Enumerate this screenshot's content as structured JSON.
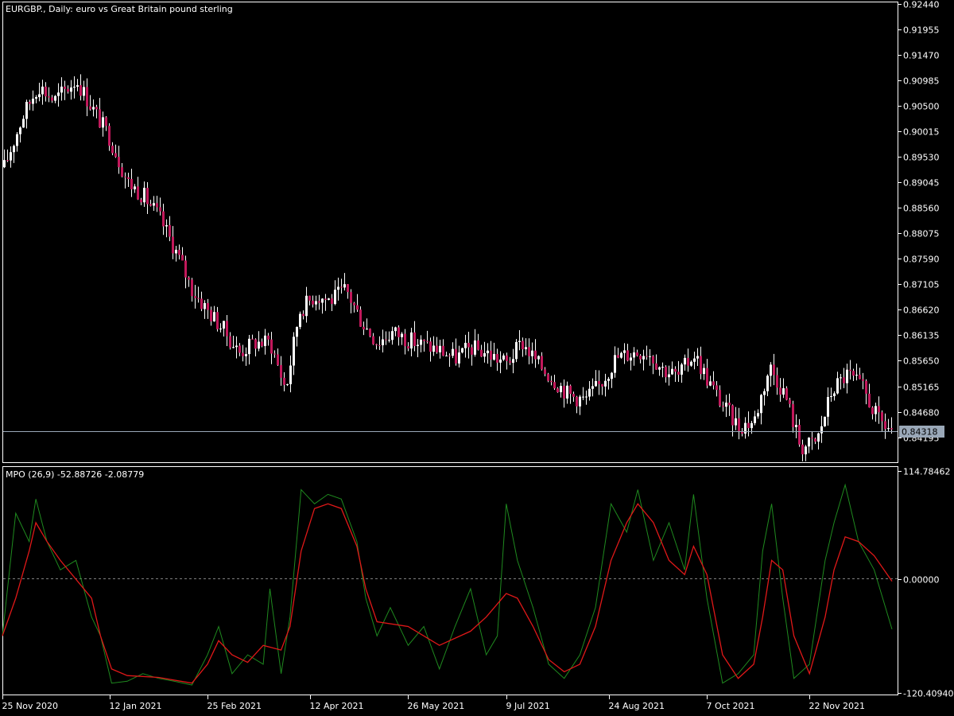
{
  "window": {
    "price_caption": "EURGBP., Daily:  euro vs Great Britain pound sterling",
    "indicator_caption": "MPO (26,9) -52.88726 -2.08779"
  },
  "colors": {
    "background": "#000000",
    "frame": "#ffffff",
    "bull_candle": "#ffffff",
    "bear_candle": "#c2185b",
    "wick": "#ffffff",
    "mpo_line": "#1f8a1f",
    "signal_line": "#e01818",
    "price_line": "#9aa8b8",
    "zero_line": "#808080"
  },
  "chart_data": [
    {
      "type": "candlestick",
      "title": "EURGBP., Daily:  euro vs Great Britain pound sterling",
      "y_ticks": [
        "0.92440",
        "0.91955",
        "0.91470",
        "0.90985",
        "0.90500",
        "0.90015",
        "0.89530",
        "0.89045",
        "0.88560",
        "0.88075",
        "0.87590",
        "0.87105",
        "0.86620",
        "0.86135",
        "0.85650",
        "0.85165",
        "0.84680",
        "0.84195"
      ],
      "ylim": [
        0.8375,
        0.9244
      ],
      "current_price": "0.84318",
      "x_ticks": [
        "25 Nov 2020",
        "12 Jan 2021",
        "25 Feb 2021",
        "12 Apr 2021",
        "26 May 2021",
        "9 Jul 2021",
        "24 Aug 2021",
        "7 Oct 2021",
        "22 Nov 2021"
      ],
      "close_series": [
        {
          "date": "2020-11-25",
          "close": 0.8925
        },
        {
          "date": "2020-12-04",
          "close": 0.903
        },
        {
          "date": "2020-12-11",
          "close": 0.909
        },
        {
          "date": "2020-12-18",
          "close": 0.906
        },
        {
          "date": "2020-12-28",
          "close": 0.91
        },
        {
          "date": "2021-01-05",
          "close": 0.904
        },
        {
          "date": "2021-01-12",
          "close": 0.899
        },
        {
          "date": "2021-01-20",
          "close": 0.8905
        },
        {
          "date": "2021-01-27",
          "close": 0.888
        },
        {
          "date": "2021-02-03",
          "close": 0.884
        },
        {
          "date": "2021-02-10",
          "close": 0.878
        },
        {
          "date": "2021-02-18",
          "close": 0.87
        },
        {
          "date": "2021-02-25",
          "close": 0.866
        },
        {
          "date": "2021-03-04",
          "close": 0.8625
        },
        {
          "date": "2021-03-11",
          "close": 0.858
        },
        {
          "date": "2021-03-18",
          "close": 0.86
        },
        {
          "date": "2021-03-25",
          "close": 0.86
        },
        {
          "date": "2021-04-01",
          "close": 0.851
        },
        {
          "date": "2021-04-07",
          "close": 0.866
        },
        {
          "date": "2021-04-14",
          "close": 0.869
        },
        {
          "date": "2021-04-21",
          "close": 0.868
        },
        {
          "date": "2021-04-28",
          "close": 0.87
        },
        {
          "date": "2021-05-05",
          "close": 0.864
        },
        {
          "date": "2021-05-12",
          "close": 0.86
        },
        {
          "date": "2021-05-19",
          "close": 0.862
        },
        {
          "date": "2021-05-26",
          "close": 0.8605
        },
        {
          "date": "2021-06-02",
          "close": 0.8595
        },
        {
          "date": "2021-06-09",
          "close": 0.8585
        },
        {
          "date": "2021-06-16",
          "close": 0.857
        },
        {
          "date": "2021-06-23",
          "close": 0.859
        },
        {
          "date": "2021-06-30",
          "close": 0.858
        },
        {
          "date": "2021-07-09",
          "close": 0.856
        },
        {
          "date": "2021-07-16",
          "close": 0.86
        },
        {
          "date": "2021-07-23",
          "close": 0.856
        },
        {
          "date": "2021-07-30",
          "close": 0.853
        },
        {
          "date": "2021-08-06",
          "close": 0.85
        },
        {
          "date": "2021-08-13",
          "close": 0.849
        },
        {
          "date": "2021-08-20",
          "close": 0.852
        },
        {
          "date": "2021-08-27",
          "close": 0.857
        },
        {
          "date": "2021-09-03",
          "close": 0.858
        },
        {
          "date": "2021-09-10",
          "close": 0.8585
        },
        {
          "date": "2021-09-17",
          "close": 0.855
        },
        {
          "date": "2021-09-24",
          "close": 0.8535
        },
        {
          "date": "2021-10-01",
          "close": 0.858
        },
        {
          "date": "2021-10-07",
          "close": 0.853
        },
        {
          "date": "2021-10-14",
          "close": 0.848
        },
        {
          "date": "2021-10-21",
          "close": 0.844
        },
        {
          "date": "2021-10-28",
          "close": 0.845
        },
        {
          "date": "2021-11-04",
          "close": 0.8555
        },
        {
          "date": "2021-11-11",
          "close": 0.85
        },
        {
          "date": "2021-11-18",
          "close": 0.84
        },
        {
          "date": "2021-11-25",
          "close": 0.841
        },
        {
          "date": "2021-12-02",
          "close": 0.851
        },
        {
          "date": "2021-12-09",
          "close": 0.854
        },
        {
          "date": "2021-12-16",
          "close": 0.851
        },
        {
          "date": "2021-12-23",
          "close": 0.845
        },
        {
          "date": "2021-12-29",
          "close": 0.8432
        }
      ]
    },
    {
      "type": "line",
      "title": "MPO (26,9) -52.88726 -2.08779",
      "y_ticks": [
        "114.78462",
        "0.00000",
        "-120.40940"
      ],
      "ylim": [
        -120.4094,
        114.78462
      ],
      "zero_line": true,
      "series": [
        {
          "key": "mpo",
          "points": [
            {
              "date": "2020-11-25",
              "value": -60
            },
            {
              "date": "2020-12-01",
              "value": 70
            },
            {
              "date": "2020-12-07",
              "value": 40
            },
            {
              "date": "2020-12-10",
              "value": 85
            },
            {
              "date": "2020-12-15",
              "value": 40
            },
            {
              "date": "2020-12-21",
              "value": 10
            },
            {
              "date": "2020-12-28",
              "value": 20
            },
            {
              "date": "2021-01-04",
              "value": -40
            },
            {
              "date": "2021-01-08",
              "value": -60
            },
            {
              "date": "2021-01-13",
              "value": -110
            },
            {
              "date": "2021-01-20",
              "value": -108
            },
            {
              "date": "2021-01-27",
              "value": -100
            },
            {
              "date": "2021-02-03",
              "value": -105
            },
            {
              "date": "2021-02-10",
              "value": -108
            },
            {
              "date": "2021-02-18",
              "value": -112
            },
            {
              "date": "2021-02-25",
              "value": -80
            },
            {
              "date": "2021-03-02",
              "value": -50
            },
            {
              "date": "2021-03-08",
              "value": -100
            },
            {
              "date": "2021-03-15",
              "value": -80
            },
            {
              "date": "2021-03-22",
              "value": -90
            },
            {
              "date": "2021-03-25",
              "value": -10
            },
            {
              "date": "2021-03-30",
              "value": -100
            },
            {
              "date": "2021-04-03",
              "value": -40
            },
            {
              "date": "2021-04-08",
              "value": 95
            },
            {
              "date": "2021-04-14",
              "value": 80
            },
            {
              "date": "2021-04-20",
              "value": 90
            },
            {
              "date": "2021-04-26",
              "value": 85
            },
            {
              "date": "2021-05-03",
              "value": 40
            },
            {
              "date": "2021-05-07",
              "value": -20
            },
            {
              "date": "2021-05-12",
              "value": -60
            },
            {
              "date": "2021-05-18",
              "value": -30
            },
            {
              "date": "2021-05-26",
              "value": -70
            },
            {
              "date": "2021-06-02",
              "value": -50
            },
            {
              "date": "2021-06-09",
              "value": -95
            },
            {
              "date": "2021-06-16",
              "value": -50
            },
            {
              "date": "2021-06-23",
              "value": -10
            },
            {
              "date": "2021-06-30",
              "value": -80
            },
            {
              "date": "2021-07-05",
              "value": -60
            },
            {
              "date": "2021-07-09",
              "value": 80
            },
            {
              "date": "2021-07-14",
              "value": 20
            },
            {
              "date": "2021-07-21",
              "value": -30
            },
            {
              "date": "2021-07-28",
              "value": -90
            },
            {
              "date": "2021-08-04",
              "value": -105
            },
            {
              "date": "2021-08-11",
              "value": -80
            },
            {
              "date": "2021-08-18",
              "value": -30
            },
            {
              "date": "2021-08-25",
              "value": 80
            },
            {
              "date": "2021-09-01",
              "value": 50
            },
            {
              "date": "2021-09-06",
              "value": 95
            },
            {
              "date": "2021-09-13",
              "value": 20
            },
            {
              "date": "2021-09-20",
              "value": 60
            },
            {
              "date": "2021-09-27",
              "value": 10
            },
            {
              "date": "2021-10-01",
              "value": 90
            },
            {
              "date": "2021-10-07",
              "value": -20
            },
            {
              "date": "2021-10-14",
              "value": -110
            },
            {
              "date": "2021-10-21",
              "value": -100
            },
            {
              "date": "2021-10-28",
              "value": -80
            },
            {
              "date": "2021-11-01",
              "value": 30
            },
            {
              "date": "2021-11-05",
              "value": 80
            },
            {
              "date": "2021-11-10",
              "value": -20
            },
            {
              "date": "2021-11-15",
              "value": -105
            },
            {
              "date": "2021-11-22",
              "value": -90
            },
            {
              "date": "2021-11-29",
              "value": 20
            },
            {
              "date": "2021-12-03",
              "value": 60
            },
            {
              "date": "2021-12-08",
              "value": 100
            },
            {
              "date": "2021-12-14",
              "value": 40
            },
            {
              "date": "2021-12-21",
              "value": 10
            },
            {
              "date": "2021-12-29",
              "value": -52.89
            }
          ]
        },
        {
          "key": "signal",
          "points": [
            {
              "date": "2020-11-25",
              "value": -60
            },
            {
              "date": "2020-12-01",
              "value": -20
            },
            {
              "date": "2020-12-07",
              "value": 30
            },
            {
              "date": "2020-12-10",
              "value": 60
            },
            {
              "date": "2020-12-15",
              "value": 40
            },
            {
              "date": "2020-12-21",
              "value": 20
            },
            {
              "date": "2021-01-04",
              "value": -20
            },
            {
              "date": "2021-01-08",
              "value": -60
            },
            {
              "date": "2021-01-13",
              "value": -95
            },
            {
              "date": "2021-01-20",
              "value": -102
            },
            {
              "date": "2021-02-03",
              "value": -104
            },
            {
              "date": "2021-02-18",
              "value": -110
            },
            {
              "date": "2021-02-25",
              "value": -90
            },
            {
              "date": "2021-03-02",
              "value": -65
            },
            {
              "date": "2021-03-08",
              "value": -80
            },
            {
              "date": "2021-03-15",
              "value": -88
            },
            {
              "date": "2021-03-22",
              "value": -70
            },
            {
              "date": "2021-03-30",
              "value": -75
            },
            {
              "date": "2021-04-03",
              "value": -50
            },
            {
              "date": "2021-04-08",
              "value": 30
            },
            {
              "date": "2021-04-14",
              "value": 75
            },
            {
              "date": "2021-04-20",
              "value": 80
            },
            {
              "date": "2021-04-26",
              "value": 75
            },
            {
              "date": "2021-05-03",
              "value": 35
            },
            {
              "date": "2021-05-07",
              "value": -10
            },
            {
              "date": "2021-05-12",
              "value": -45
            },
            {
              "date": "2021-05-26",
              "value": -50
            },
            {
              "date": "2021-06-09",
              "value": -70
            },
            {
              "date": "2021-06-23",
              "value": -55
            },
            {
              "date": "2021-06-30",
              "value": -40
            },
            {
              "date": "2021-07-09",
              "value": -15
            },
            {
              "date": "2021-07-14",
              "value": -20
            },
            {
              "date": "2021-07-21",
              "value": -50
            },
            {
              "date": "2021-07-28",
              "value": -85
            },
            {
              "date": "2021-08-04",
              "value": -98
            },
            {
              "date": "2021-08-11",
              "value": -90
            },
            {
              "date": "2021-08-18",
              "value": -50
            },
            {
              "date": "2021-08-25",
              "value": 20
            },
            {
              "date": "2021-09-01",
              "value": 60
            },
            {
              "date": "2021-09-06",
              "value": 80
            },
            {
              "date": "2021-09-13",
              "value": 60
            },
            {
              "date": "2021-09-20",
              "value": 20
            },
            {
              "date": "2021-09-27",
              "value": 5
            },
            {
              "date": "2021-10-01",
              "value": 35
            },
            {
              "date": "2021-10-07",
              "value": 5
            },
            {
              "date": "2021-10-14",
              "value": -80
            },
            {
              "date": "2021-10-21",
              "value": -105
            },
            {
              "date": "2021-10-28",
              "value": -90
            },
            {
              "date": "2021-11-01",
              "value": -40
            },
            {
              "date": "2021-11-05",
              "value": 20
            },
            {
              "date": "2021-11-10",
              "value": 10
            },
            {
              "date": "2021-11-15",
              "value": -60
            },
            {
              "date": "2021-11-22",
              "value": -100
            },
            {
              "date": "2021-11-29",
              "value": -40
            },
            {
              "date": "2021-12-03",
              "value": 10
            },
            {
              "date": "2021-12-08",
              "value": 45
            },
            {
              "date": "2021-12-14",
              "value": 40
            },
            {
              "date": "2021-12-21",
              "value": 25
            },
            {
              "date": "2021-12-29",
              "value": -2.09
            }
          ]
        }
      ]
    }
  ]
}
